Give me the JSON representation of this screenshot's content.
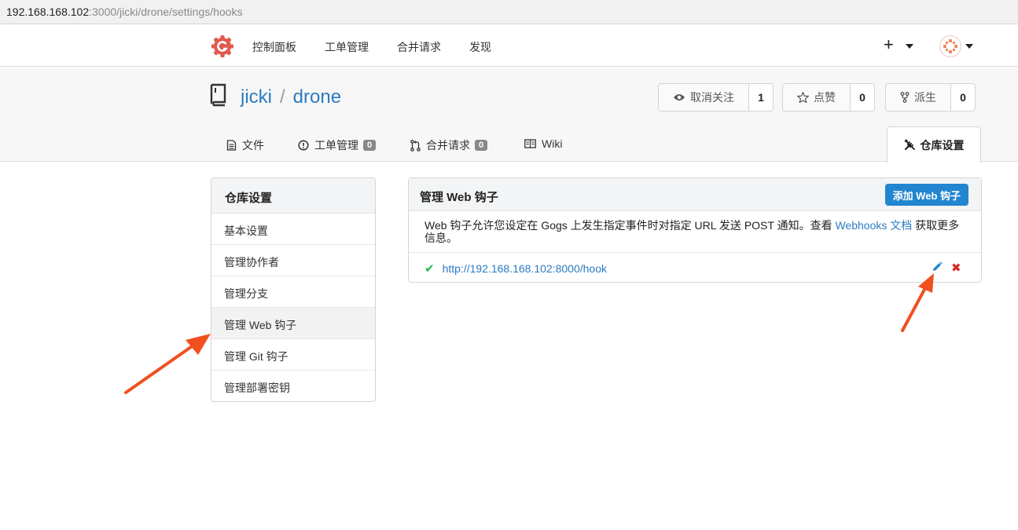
{
  "urlbar": {
    "host": "192.168.168.102",
    "path": ":3000/jicki/drone/settings/hooks"
  },
  "nav": {
    "items": [
      "控制面板",
      "工单管理",
      "合并请求",
      "发现"
    ],
    "plus": "+"
  },
  "repo": {
    "owner": "jicki",
    "separator": "/",
    "name": "drone",
    "watch": {
      "label": "取消关注",
      "count": "1"
    },
    "star": {
      "label": "点赞",
      "count": "0"
    },
    "fork": {
      "label": "派生",
      "count": "0"
    }
  },
  "tabs": {
    "files": "文件",
    "issues": "工单管理",
    "issues_count": "0",
    "pulls": "合并请求",
    "pulls_count": "0",
    "wiki": "Wiki",
    "settings": "仓库设置"
  },
  "sidebar": {
    "title": "仓库设置",
    "items": [
      {
        "label": "基本设置"
      },
      {
        "label": "管理协作者"
      },
      {
        "label": "管理分支"
      },
      {
        "label": "管理 Web 钩子"
      },
      {
        "label": "管理 Git 钩子"
      },
      {
        "label": "管理部署密钥"
      }
    ]
  },
  "webhooks": {
    "title": "管理 Web 钩子",
    "add_button": "添加 Web 钩子",
    "desc_before": "Web 钩子允许您设定在 Gogs 上发生指定事件时对指定 URL 发送 POST 通知。查看 ",
    "desc_link": "Webhooks 文档",
    "desc_after": " 获取更多信息。",
    "hooks": [
      {
        "url": "http://192.168.168.102:8000/hook",
        "status": "success"
      }
    ]
  },
  "colors": {
    "link": "#2b7bc1",
    "primary_button": "#2185d0",
    "success": "#21ba45",
    "danger": "#db2828",
    "annotation_arrow": "#f0501e"
  }
}
